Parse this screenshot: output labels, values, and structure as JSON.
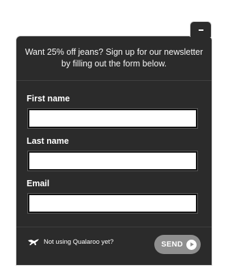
{
  "widget": {
    "intro_text": "Want 25% off jeans? Sign up for our newsletter by filling out the form below.",
    "minimize_symbol": "−"
  },
  "form": {
    "fields": [
      {
        "label": "First name",
        "value": "",
        "placeholder": ""
      },
      {
        "label": "Last name",
        "value": "",
        "placeholder": ""
      },
      {
        "label": "Email",
        "value": "",
        "placeholder": ""
      }
    ]
  },
  "footer": {
    "brand_text": "Not using Qualaroo yet?",
    "brand_icon": "kangaroo-icon",
    "send_label": "SEND",
    "send_icon": "play-circle-icon"
  },
  "colors": {
    "panel_background": "#2b2b2b",
    "panel_border": "#d2d2d2",
    "send_button_background": "#8f8f8f",
    "input_background": "#ffffff"
  }
}
